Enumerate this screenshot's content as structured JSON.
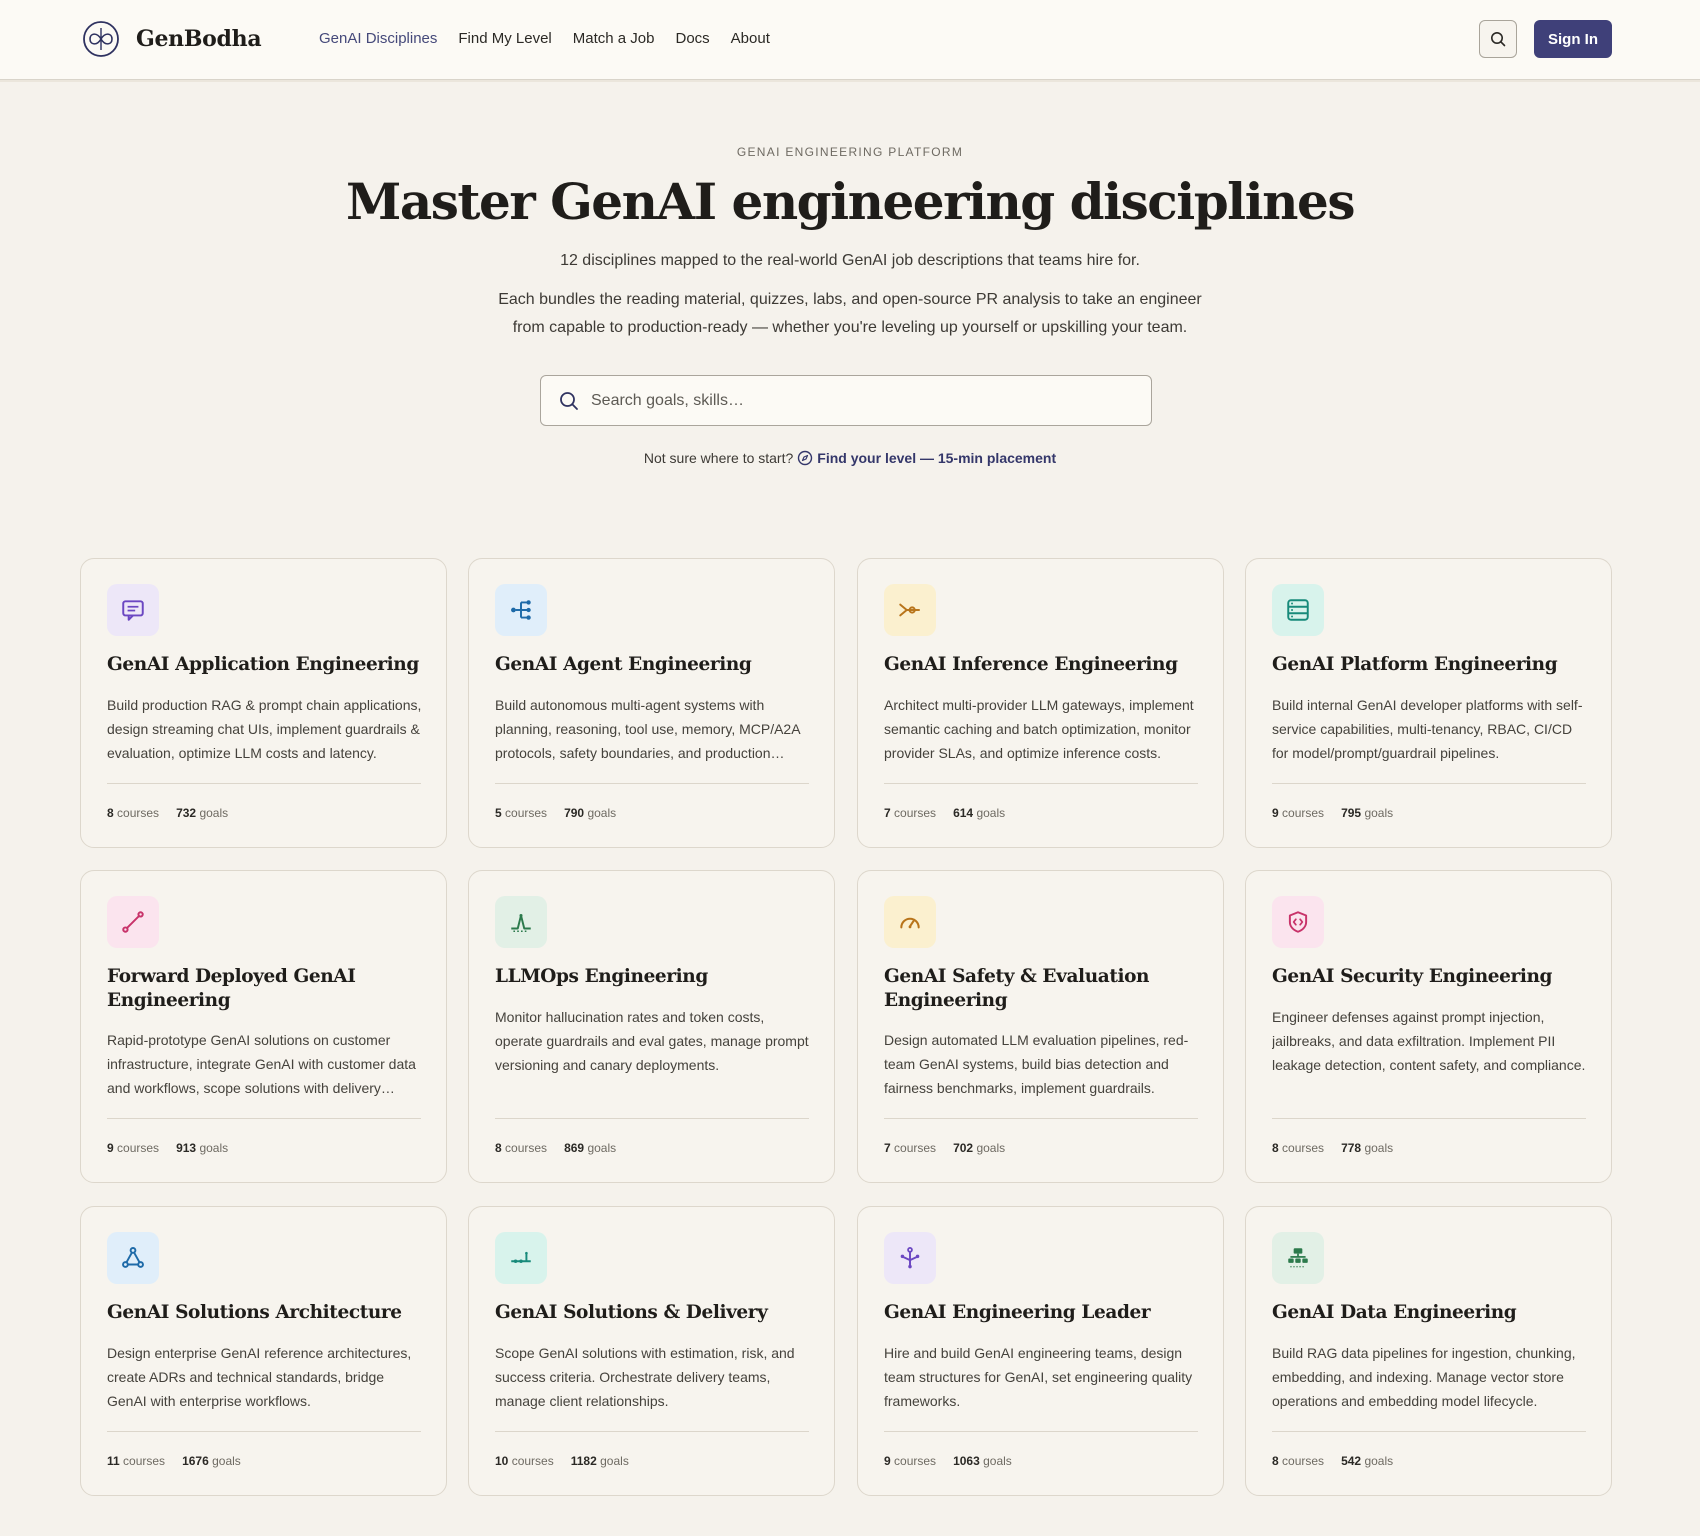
{
  "nav": {
    "brand": "GenBodha",
    "links": [
      "GenAI Disciplines",
      "Find My Level",
      "Match a Job",
      "Docs",
      "About"
    ],
    "active_index": 0,
    "sign_in": "Sign In"
  },
  "hero": {
    "eyebrow": "GENAI ENGINEERING PLATFORM",
    "title": "Master GenAI engineering disciplines",
    "subtitle": "12 disciplines mapped to the real-world GenAI job descriptions that teams hire for.",
    "description": "Each bundles the reading material, quizzes, labs, and open-source PR analysis to take an engineer from capable to production-ready — whether you're leveling up yourself or upskilling your team.",
    "search_placeholder": "Search goals, skills…",
    "placement_prompt": "Not sure where to start?",
    "placement_link": "Find your level — 15-min placement"
  },
  "stat_labels": {
    "courses": "courses",
    "goals": "goals"
  },
  "colors": {
    "accent": "#3f4079",
    "active_link": "#45497a"
  },
  "disciplines": [
    {
      "title": "GenAI Application Engineering",
      "desc": "Build production RAG & prompt chain applications, design streaming chat UIs, implement guardrails & evaluation, optimize LLM costs and latency.",
      "courses": "8",
      "goals": "732",
      "icon": "message-icon",
      "bg": "#ede7f8",
      "fg": "#6b47c2"
    },
    {
      "title": "GenAI Agent Engineering",
      "desc": "Build autonomous multi-agent systems with planning, reasoning, tool use, memory, MCP/A2A protocols, safety boundaries, and production deployment.",
      "courses": "5",
      "goals": "790",
      "icon": "workflow-icon",
      "bg": "#e0eefa",
      "fg": "#1e6aa8"
    },
    {
      "title": "GenAI Inference Engineering",
      "desc": "Architect multi-provider LLM gateways, implement semantic caching and batch optimization, monitor provider SLAs, and optimize inference costs.",
      "courses": "7",
      "goals": "614",
      "icon": "merge-icon",
      "bg": "#fbf0cf",
      "fg": "#b8741a"
    },
    {
      "title": "GenAI Platform Engineering",
      "desc": "Build internal GenAI developer platforms with self-service capabilities, multi-tenancy, RBAC, CI/CD for model/prompt/guardrail pipelines.",
      "courses": "9",
      "goals": "795",
      "icon": "server-icon",
      "bg": "#d8f3ec",
      "fg": "#178a7a"
    },
    {
      "title": "Forward Deployed GenAI Engineering",
      "desc": "Rapid-prototype GenAI solutions on customer infrastructure, integrate GenAI with customer data and workflows, scope solutions with delivery teams.",
      "courses": "9",
      "goals": "913",
      "icon": "route-icon",
      "bg": "#fbe4ee",
      "fg": "#c8336a"
    },
    {
      "title": "LLMOps Engineering",
      "desc": "Monitor hallucination rates and token costs, operate guardrails and eval gates, manage prompt versioning and canary deployments.",
      "courses": "8",
      "goals": "869",
      "icon": "pulse-icon",
      "bg": "#e2f0e6",
      "fg": "#2c7a4c"
    },
    {
      "title": "GenAI Safety & Evaluation Engineering",
      "desc": "Design automated LLM evaluation pipelines, red-team GenAI systems, build bias detection and fairness benchmarks, implement guardrails.",
      "courses": "7",
      "goals": "702",
      "icon": "gauge-icon",
      "bg": "#fbf0cf",
      "fg": "#b8741a"
    },
    {
      "title": "GenAI Security Engineering",
      "desc": "Engineer defenses against prompt injection, jailbreaks, and data exfiltration. Implement PII leakage detection, content safety, and compliance.",
      "courses": "8",
      "goals": "778",
      "icon": "shield-code-icon",
      "bg": "#fbe4ee",
      "fg": "#c8336a"
    },
    {
      "title": "GenAI Solutions Architecture",
      "desc": "Design enterprise GenAI reference architectures, create ADRs and technical standards, bridge GenAI with enterprise workflows.",
      "courses": "11",
      "goals": "1676",
      "icon": "network-icon",
      "bg": "#e0eefa",
      "fg": "#1e6aa8"
    },
    {
      "title": "GenAI Solutions & Delivery",
      "desc": "Scope GenAI solutions with estimation, risk, and success criteria. Orchestrate delivery teams, manage client relationships.",
      "courses": "10",
      "goals": "1182",
      "icon": "timeline-icon",
      "bg": "#d8f3ec",
      "fg": "#178a7a"
    },
    {
      "title": "GenAI Engineering Leader",
      "desc": "Hire and build GenAI engineering teams, design team structures for GenAI, set engineering quality frameworks.",
      "courses": "9",
      "goals": "1063",
      "icon": "branch-icon",
      "bg": "#ede7f8",
      "fg": "#6b47c2"
    },
    {
      "title": "GenAI Data Engineering",
      "desc": "Build RAG data pipelines for ingestion, chunking, embedding, and indexing. Manage vector store operations and embedding model lifecycle.",
      "courses": "8",
      "goals": "542",
      "icon": "hierarchy-icon",
      "bg": "#e2f0e6",
      "fg": "#2c7a4c"
    }
  ]
}
